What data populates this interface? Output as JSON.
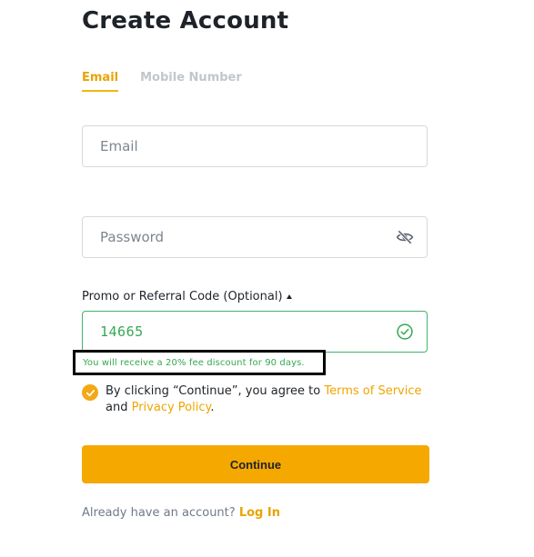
{
  "page": {
    "title": "Create Account"
  },
  "tabs": [
    {
      "label": "Email",
      "active": true
    },
    {
      "label": "Mobile Number",
      "active": false
    }
  ],
  "email": {
    "placeholder": "Email",
    "value": ""
  },
  "password": {
    "placeholder": "Password",
    "value": "",
    "toggle_icon": "eye-off-icon"
  },
  "promo": {
    "label": "Promo or Referral Code (Optional)",
    "value": "14665",
    "status_icon": "check-circle-icon",
    "discount_message": "You will receive a 20% fee discount for 90 days."
  },
  "agreement": {
    "checked": true,
    "prefix": "By clicking “Continue”, you agree to ",
    "terms_link": "Terms of Service",
    "middle": "and ",
    "privacy_link": "Privacy Policy",
    "suffix": "."
  },
  "continue_button": {
    "label": "Continue"
  },
  "footer": {
    "prompt": "Already have an account?",
    "login_link": "Log In"
  },
  "colors": {
    "accent": "#f5a800",
    "success": "#35a853",
    "text": "#1e2329",
    "muted": "#707a8a"
  }
}
